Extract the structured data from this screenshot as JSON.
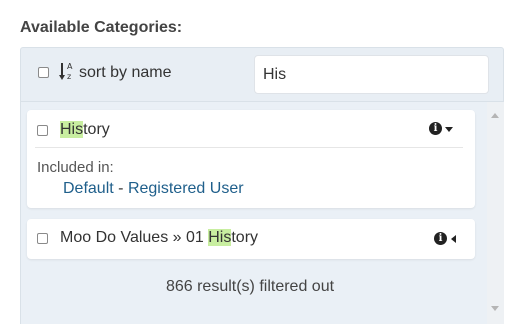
{
  "panel": {
    "title": "Available Categories:"
  },
  "toolbar": {
    "sort_label": "sort by name",
    "sort_icon": "sort-alpha-asc-icon",
    "filter_value": "His"
  },
  "items": [
    {
      "label_match": "His",
      "label_rest": "tory",
      "included_label": "Included in:",
      "roles": [
        "Default",
        "Registered User"
      ],
      "separator": "-",
      "expanded": true
    },
    {
      "label_prefix": "Moo Do Values » 01 ",
      "label_match": "His",
      "label_rest": "tory",
      "expanded": false
    }
  ],
  "filtered_out": "866 result(s) filtered out",
  "colors": {
    "highlight": "#c8eea0",
    "link": "#1f5f8b",
    "list_bg": "#eaf0f6",
    "toolbar_bg": "#e8eef4"
  }
}
